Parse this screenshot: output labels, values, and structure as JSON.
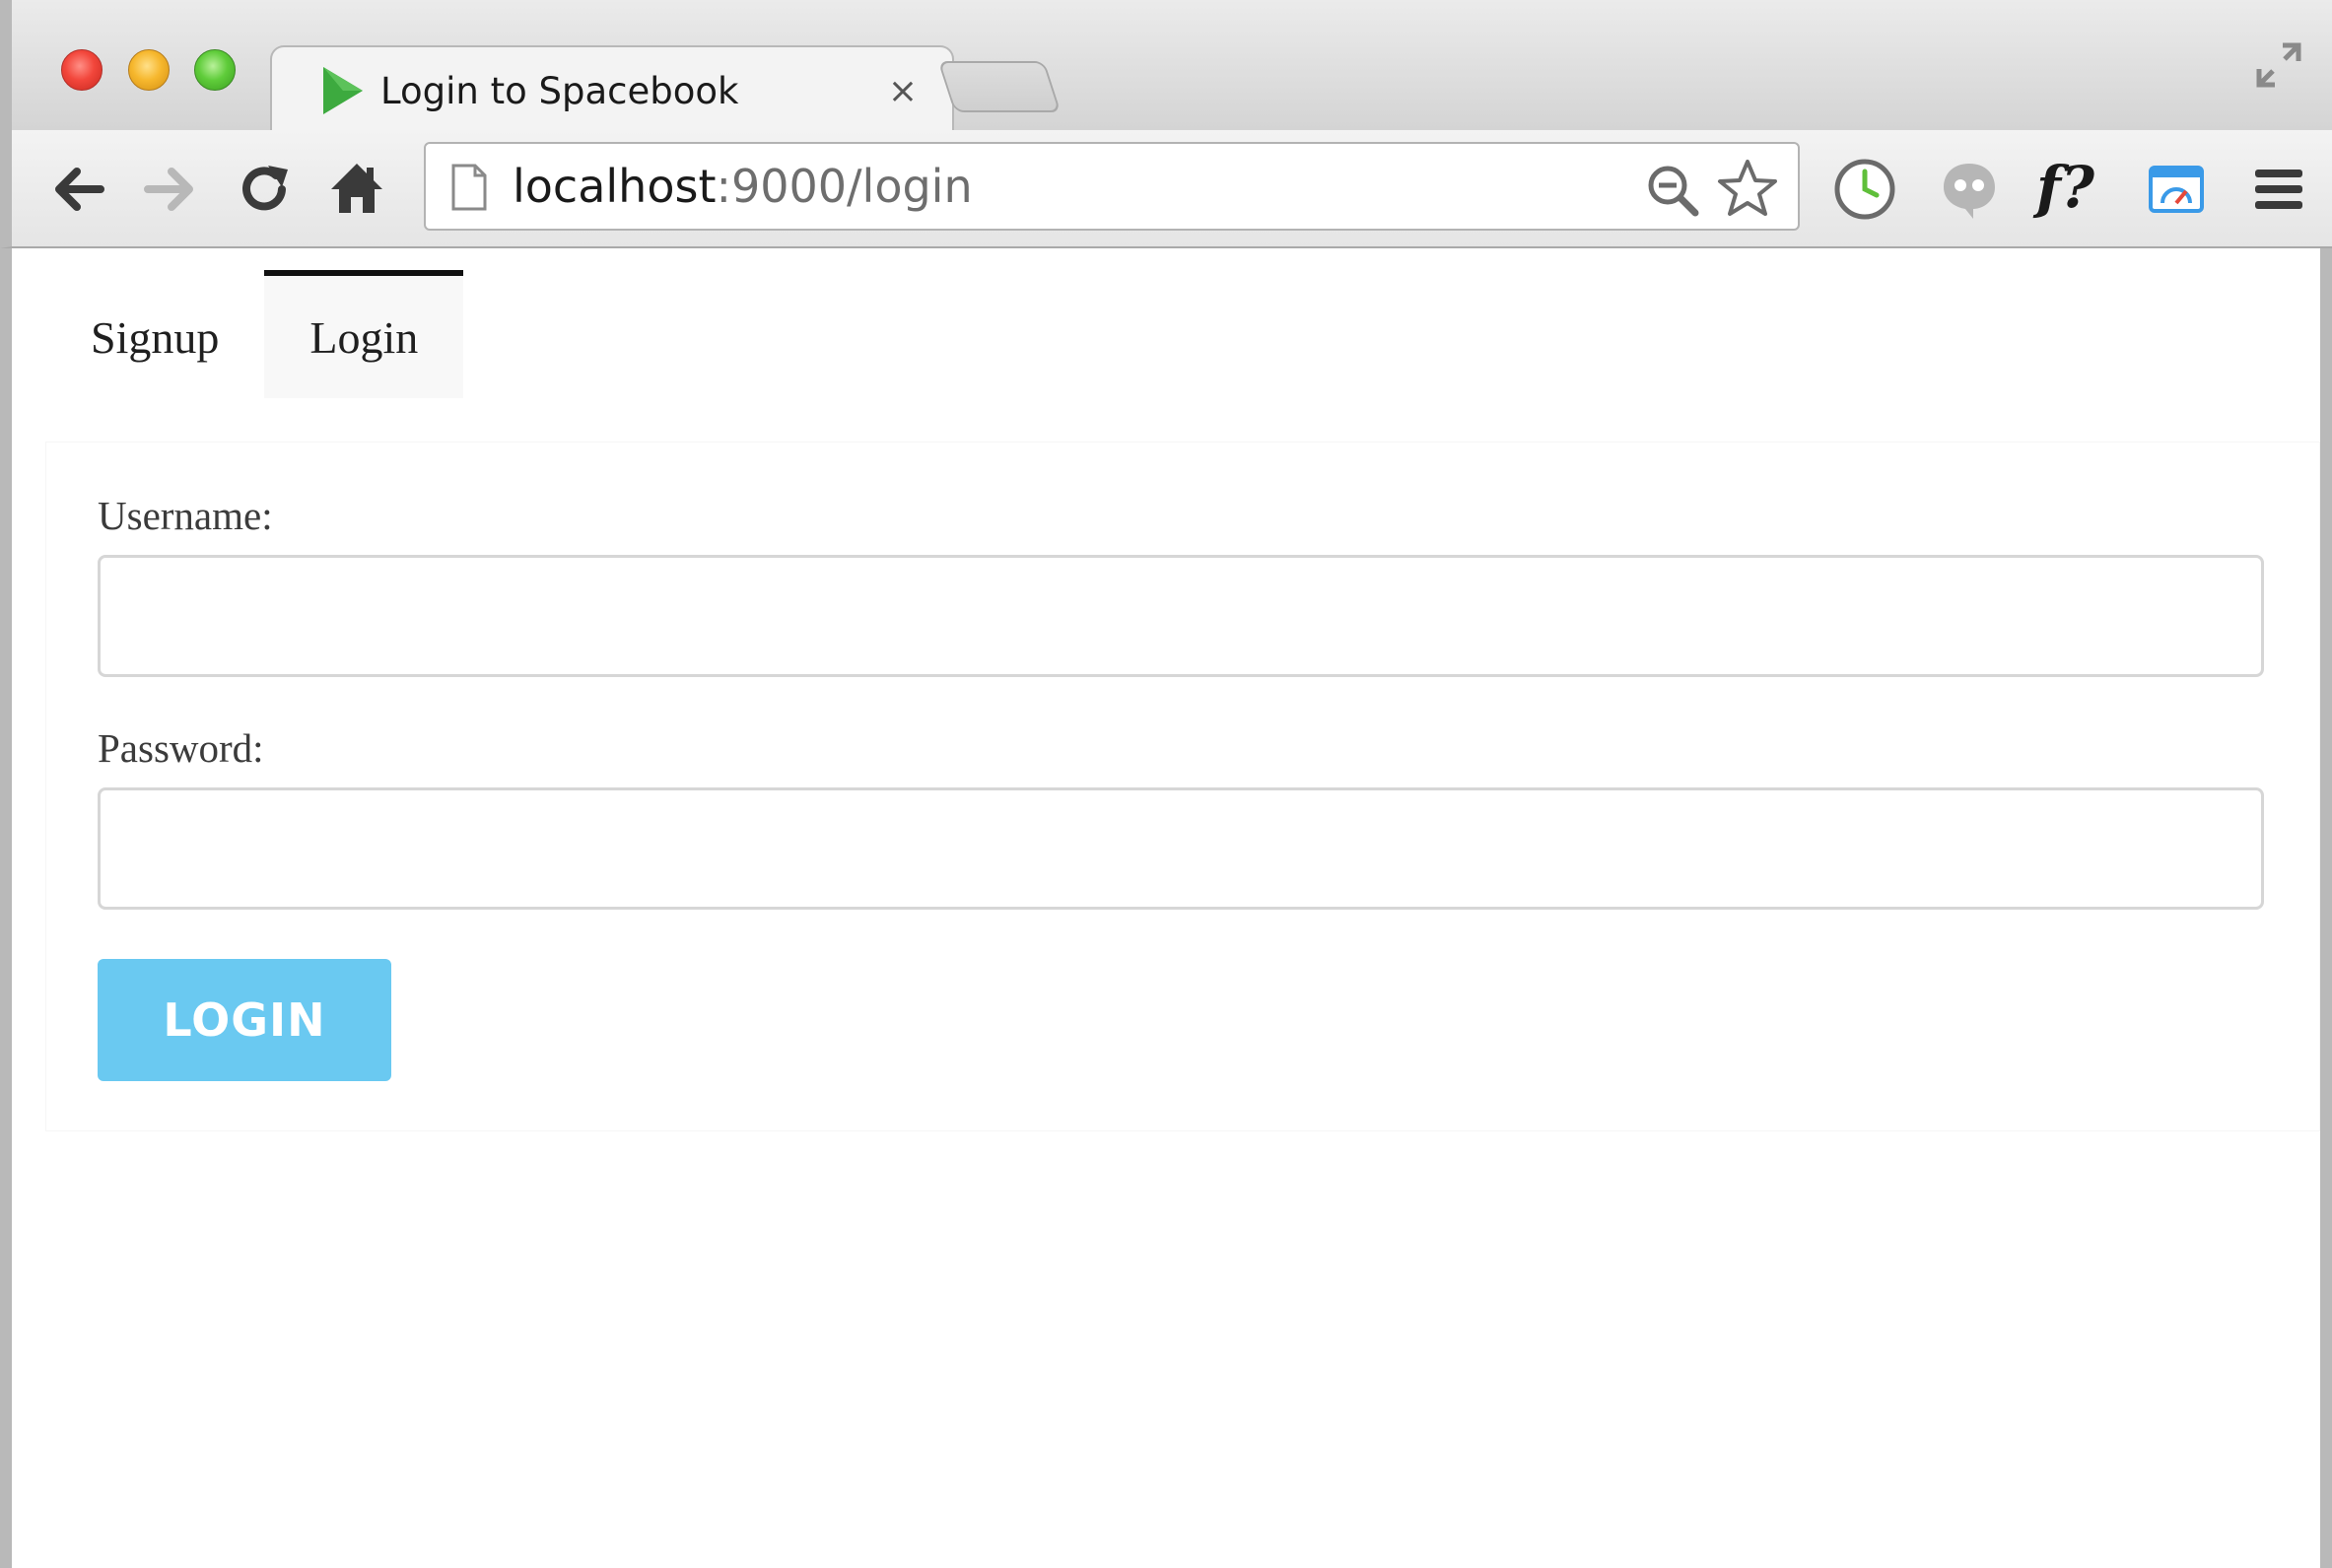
{
  "browser": {
    "tab": {
      "title": "Login to Spacebook",
      "close_glyph": "×",
      "favicon": "play-triangle-icon"
    },
    "address_bar": {
      "host": "localhost",
      "path": ":9000/login"
    },
    "toolbar_icons": [
      "back-arrow-icon",
      "forward-arrow-icon",
      "reload-icon",
      "home-icon",
      "zoom-icon",
      "star-icon",
      "clock-extension-icon",
      "quote-extension-icon",
      "font-extension-icon",
      "speed-extension-icon",
      "menu-icon"
    ],
    "extensions": {
      "font_label": "f?"
    }
  },
  "page": {
    "nav": {
      "tabs": [
        {
          "label": "Signup",
          "active": false
        },
        {
          "label": "Login",
          "active": true
        }
      ]
    },
    "form": {
      "username_label": "Username:",
      "username_value": "",
      "password_label": "Password:",
      "password_value": "",
      "submit_label": "LOGIN"
    }
  },
  "colors": {
    "login_button": "#6ac9f1",
    "favicon_green": "#3daa3f",
    "clock_green": "#5fbf3a",
    "speed_blue": "#3a9ae8"
  }
}
